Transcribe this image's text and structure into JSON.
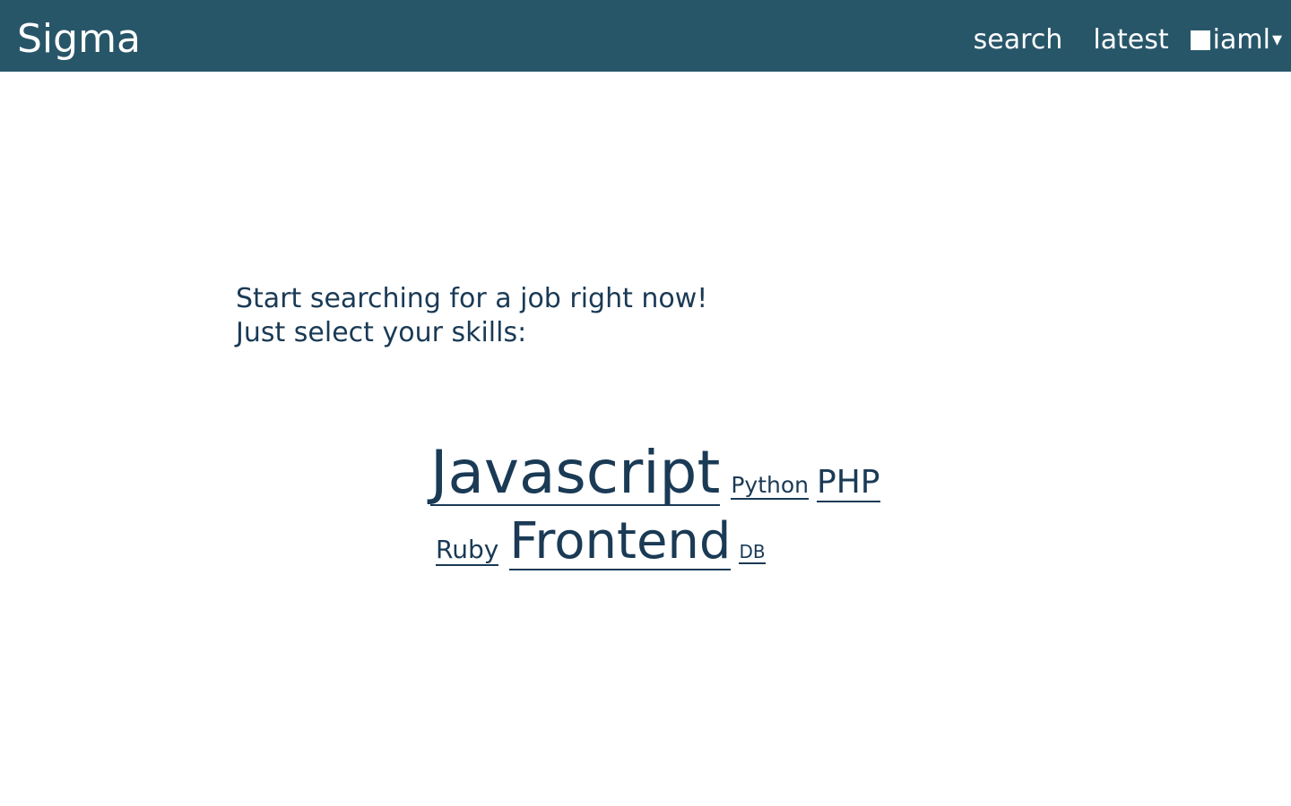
{
  "header": {
    "brand": "Sigma",
    "nav": {
      "search": "search",
      "latest": "latest",
      "user": "iaml",
      "caret": "▾"
    }
  },
  "main": {
    "intro_line1": "Start searching for a job right now!",
    "intro_line2": "Just select your skills:"
  },
  "skills": {
    "javascript": "Javascript",
    "python": "Python",
    "php": "PHP",
    "ruby": "Ruby",
    "frontend": "Frontend",
    "db": "DB"
  },
  "colors": {
    "header_bg": "#285669",
    "text": "#1a3a55"
  },
  "icons": {
    "user": "user-avatar-square-icon",
    "dropdown": "chevron-down-icon"
  }
}
